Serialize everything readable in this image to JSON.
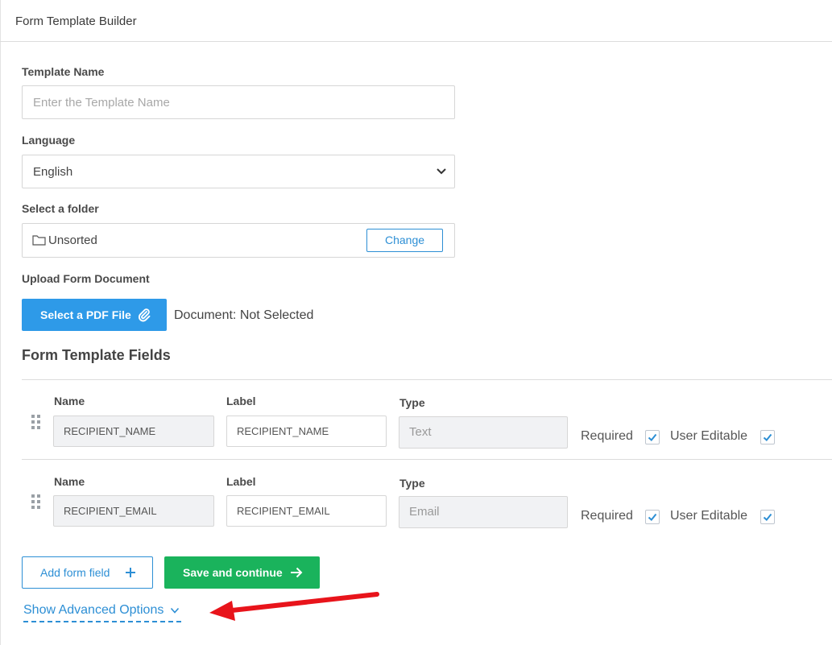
{
  "header": {
    "title": "Form Template Builder"
  },
  "template_name": {
    "label": "Template Name",
    "placeholder": "Enter the Template Name",
    "value": ""
  },
  "language": {
    "label": "Language",
    "selected": "English",
    "icon": "chevron-down-icon"
  },
  "folder": {
    "label": "Select a folder",
    "value": "Unsorted",
    "change_label": "Change",
    "icon": "folder-icon"
  },
  "upload": {
    "label": "Upload Form Document",
    "button_label": "Select a PDF File",
    "button_icon": "paperclip-icon",
    "status": "Document: Not Selected"
  },
  "fields_section": {
    "title": "Form Template Fields",
    "rows": [
      {
        "name_header": "Name",
        "label_header": "Label",
        "type_header": "Type",
        "name": "RECIPIENT_NAME",
        "label": "RECIPIENT_NAME",
        "type": "Text",
        "required_label": "Required",
        "required": true,
        "editable_label": "User Editable",
        "editable": true
      },
      {
        "name_header": "Name",
        "label_header": "Label",
        "type_header": "Type",
        "name": "RECIPIENT_EMAIL",
        "label": "RECIPIENT_EMAIL",
        "type": "Email",
        "required_label": "Required",
        "required": true,
        "editable_label": "User Editable",
        "editable": true
      }
    ]
  },
  "actions": {
    "add_field_label": "Add form field",
    "save_label": "Save and continue",
    "advanced_label": "Show Advanced Options"
  },
  "colors": {
    "primary_blue": "#2e9ae8",
    "link_blue": "#2d8fd5",
    "success_green": "#1ab35c",
    "annotation_red": "#e8141b"
  }
}
